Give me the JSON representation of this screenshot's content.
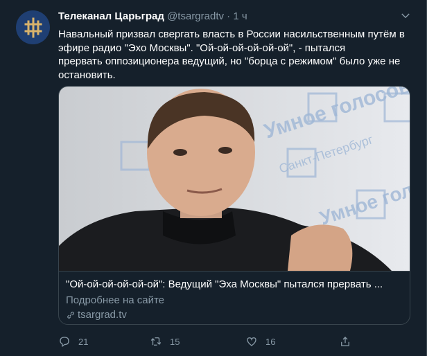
{
  "tweet": {
    "author_name": "Телеканал Царьград",
    "handle": "@tsargradtv",
    "separator": "·",
    "time": "1 ч",
    "text_lines": [
      "Навальный призвал свергать власть в России насильственным путём в",
      "эфире радио \"Эхо Москвы\". \"Ой-ой-ой-ой-ой-ой\", - пытался",
      "прервать оппозиционера ведущий, но \"борца с режимом\" было уже не",
      "остановить."
    ]
  },
  "card": {
    "title": "\"Ой-ой-ой-ой-ой-ой\": Ведущий \"Эха Москвы\" пытался прервать ...",
    "description": "Подробнее на сайте",
    "domain": "tsargrad.tv",
    "photo_background_text": [
      "Умное голосование",
      "Санкт-Петербург"
    ]
  },
  "actions": {
    "replies": "21",
    "retweets": "15",
    "likes": "16"
  },
  "colors": {
    "background": "#15202b",
    "border": "#38444d",
    "muted": "#8899a6",
    "text": "#ffffff",
    "avatar_bg": "#1f3f73",
    "logo_gold": "#d9b36b"
  },
  "icons": [
    "caret-down-icon",
    "reply-icon",
    "retweet-icon",
    "like-icon",
    "share-icon",
    "link-icon"
  ]
}
